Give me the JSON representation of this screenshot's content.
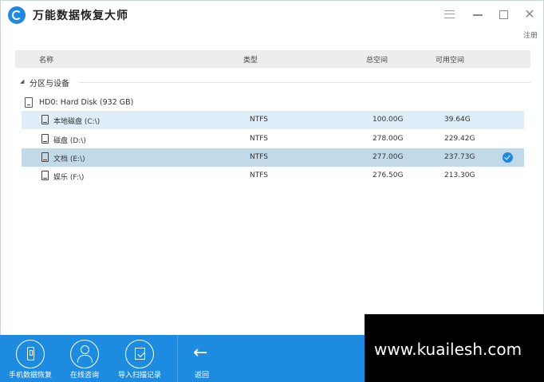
{
  "app": {
    "title": "万能数据恢复大师"
  },
  "titlebar": {
    "register_label": "注册"
  },
  "table": {
    "headers": {
      "name": "名称",
      "type": "类型",
      "total": "总空间",
      "free": "可用空间"
    }
  },
  "section": {
    "label": "分区与设备"
  },
  "disk": {
    "label": "HD0: Hard Disk (932 GB)"
  },
  "partitions": [
    {
      "name": "本地磁盘 (C:\\)",
      "fs": "NTFS",
      "total": "100.00G",
      "free": "39.64G",
      "selected": false
    },
    {
      "name": "磁盘 (D:\\)",
      "fs": "NTFS",
      "total": "278.00G",
      "free": "229.42G",
      "selected": false
    },
    {
      "name": "文档 (E:\\)",
      "fs": "NTFS",
      "total": "277.00G",
      "free": "237.73G",
      "selected": true
    },
    {
      "name": "娱乐 (F:\\)",
      "fs": "NTFS",
      "total": "276.50G",
      "free": "213.30G",
      "selected": false
    }
  ],
  "bottom_bar": {
    "phone_recovery": "手机数据恢复",
    "online_consult": "在线咨询",
    "import_scan": "导入扫描记录",
    "back": "返回"
  },
  "watermark": {
    "text": "www.kuailesh.com"
  },
  "colors": {
    "accent": "#1d8ce0",
    "row_highlight": "#deedf8",
    "row_selected": "#c2d9ea",
    "header_bg": "#ededed"
  },
  "icons": {
    "logo": "app-logo-icon",
    "menu": "menu-icon",
    "minimize": "minimize-icon",
    "maximize": "maximize-icon",
    "close": "close-icon",
    "disk": "hard-disk-icon",
    "partition": "partition-icon",
    "check": "check-icon",
    "phone": "phone-icon",
    "chat": "person-icon",
    "import": "import-doc-icon",
    "back": "back-arrow-icon"
  }
}
